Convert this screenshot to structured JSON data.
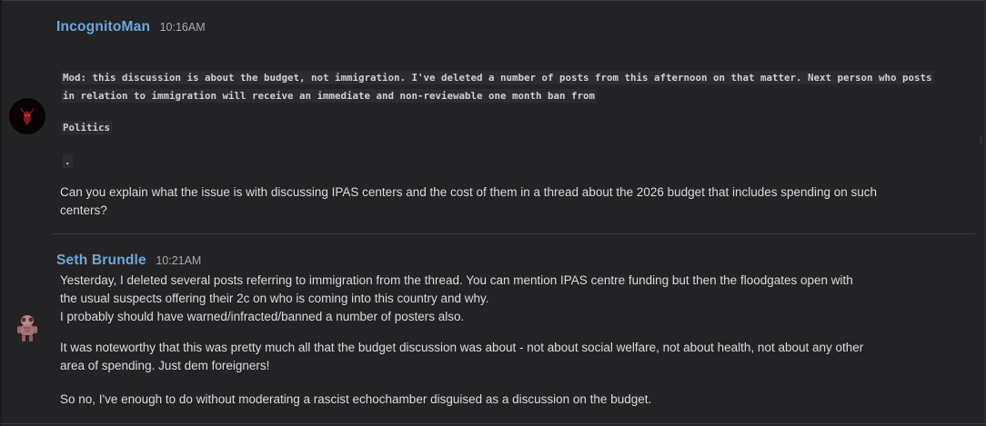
{
  "posts": [
    {
      "author": "IncognitoMan",
      "time": "10:16AM",
      "avatar_icon": "red-demon-avatar-icon",
      "mod_note_line1": "Mod: this discussion is about the budget, not immigration. I've deleted a number of posts from this afternoon on that matter. Next person who posts",
      "mod_note_line2": "in relation to immigration will receive an immediate and non-reviewable one month ban from ",
      "mod_note_forum": "Politics",
      "mod_note_end": ".",
      "body_line1": "Can you explain what the issue is with discussing IPAS centers and the cost of them in a thread about the 2026 budget that includes spending on such",
      "body_line2": "centers?"
    },
    {
      "author": "Seth Brundle",
      "time": "10:21AM",
      "avatar_icon": "fly-creature-avatar-icon",
      "para1_line1": "Yesterday, I deleted several posts referring to immigration from the thread. You can mention IPAS centre funding but then the floodgates open with",
      "para1_line2": "the usual suspects offering their 2c on who is coming into this country and why.",
      "para1_line3": "I probably should have warned/infracted/banned a number of posters also.",
      "para2_line1": "It was noteworthy that this was pretty much all that the budget discussion was about - not about social welfare, not about health, not about any other",
      "para2_line2": "area of spending. Just dem foreigners!",
      "para3_line1": "So no, I've enough to do without moderating a rascist echochamber disguised as a discussion on the budget."
    }
  ],
  "colors": {
    "background": "#232325",
    "author": "#6fa8dc",
    "text": "#dcdcde",
    "timestamp": "#a9a9ac",
    "code_background": "#2c2c30"
  }
}
